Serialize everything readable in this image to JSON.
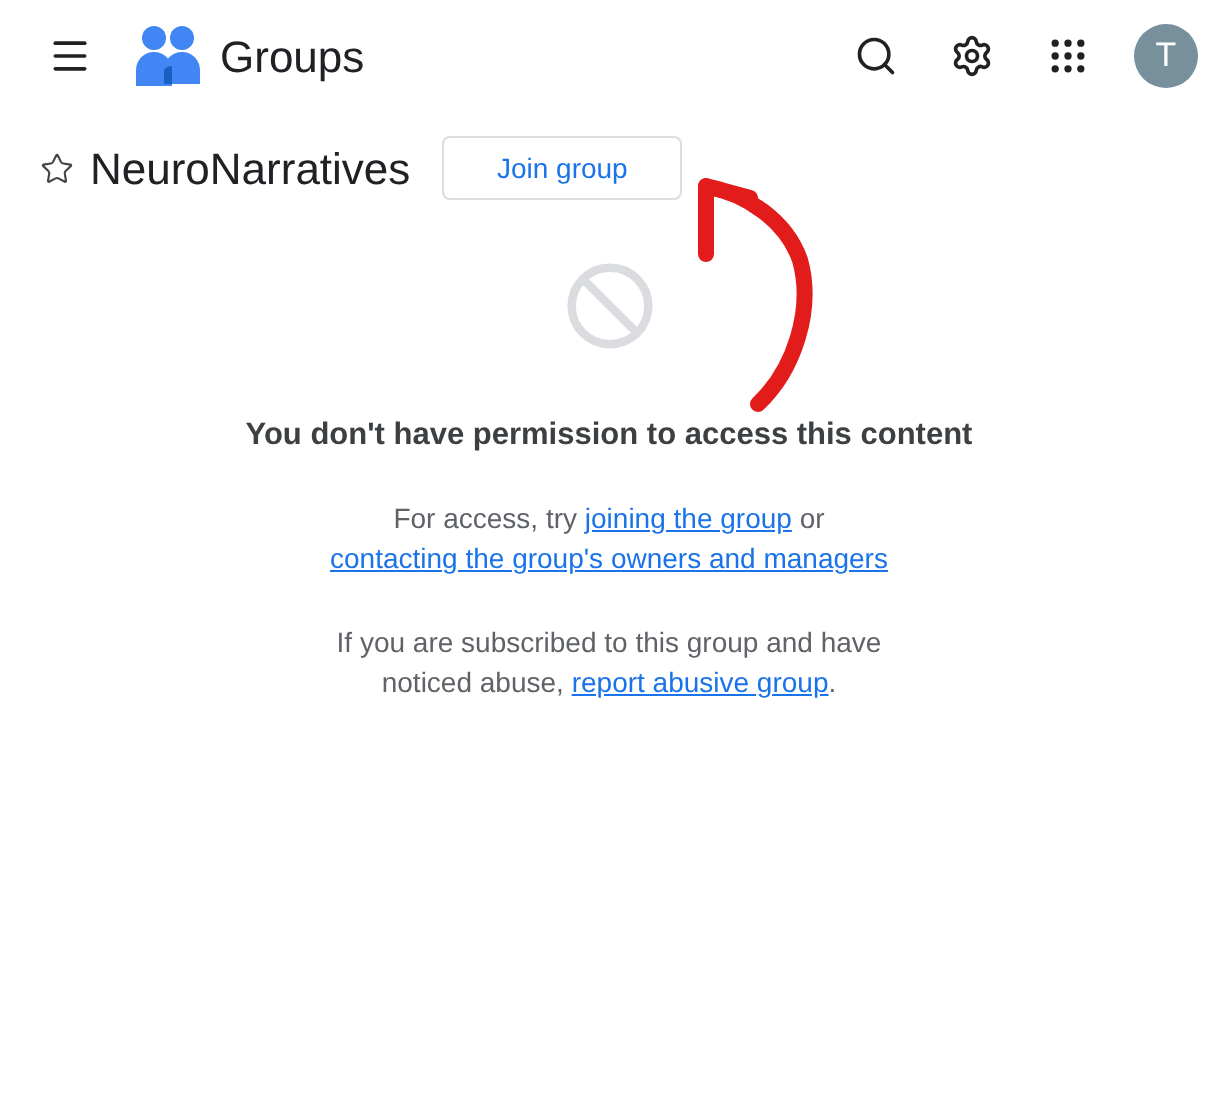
{
  "header": {
    "app_name": "Groups",
    "avatar_letter": "T"
  },
  "group": {
    "name": "NeuroNarratives",
    "starred": false,
    "join_button": "Join group"
  },
  "message": {
    "heading": "You don't have permission to access this content",
    "access": {
      "before": "For access, try",
      "link_join": "joining the group",
      "middle": "or",
      "link_contact": "contacting the group's owners and managers"
    },
    "abuse": {
      "before": "If you are subscribed to this group and have noticed abuse,",
      "link": "report abusive group",
      "after": "."
    }
  }
}
